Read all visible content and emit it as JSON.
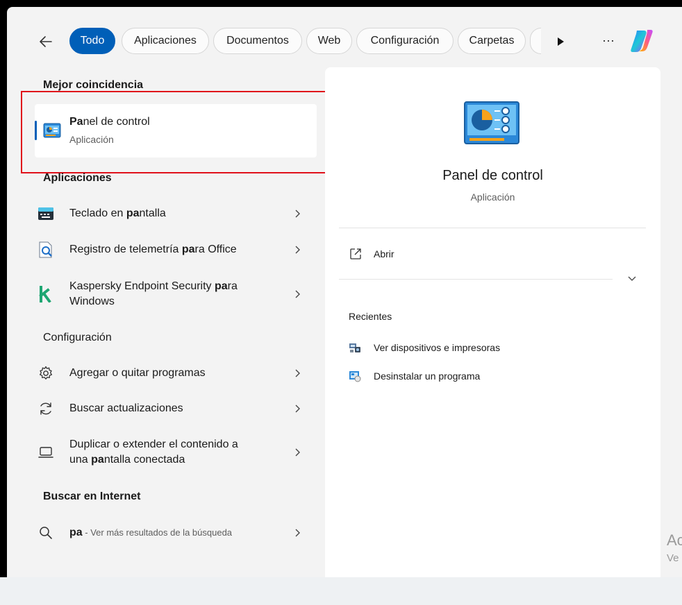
{
  "filters": {
    "tabs": [
      {
        "label": "Todo",
        "active": true
      },
      {
        "label": "Aplicaciones",
        "active": false
      },
      {
        "label": "Documentos",
        "active": false
      },
      {
        "label": "Web",
        "active": false
      },
      {
        "label": "Configuración",
        "active": false
      },
      {
        "label": "Carpetas",
        "active": false
      }
    ],
    "more_label": "···"
  },
  "best_match": {
    "heading": "Mejor coincidencia",
    "title_bold": "Pa",
    "title_rest": "nel de control",
    "subtitle": "Aplicación"
  },
  "apps": {
    "heading": "Aplicaciones",
    "items": [
      {
        "pre": "Teclado en ",
        "bold": "pa",
        "post": "ntalla",
        "icon": "keyboard-icon"
      },
      {
        "pre": "Registro de telemetría ",
        "bold": "pa",
        "post": "ra Office",
        "icon": "telemetry-log-icon"
      },
      {
        "line1_pre": "Kaspersky Endpoint Security ",
        "line1_bold": "pa",
        "line1_post": "ra",
        "line2": "Windows",
        "icon": "kaspersky-icon"
      }
    ]
  },
  "settings": {
    "heading": "Configuración",
    "items": [
      {
        "text": "Agregar o quitar programas",
        "icon": "gear-icon"
      },
      {
        "text": "Buscar actualizaciones",
        "icon": "refresh-icon"
      },
      {
        "line1": "Duplicar o extender el contenido a",
        "line2_pre": "una ",
        "line2_bold": "pa",
        "line2_post": "ntalla conectada",
        "icon": "laptop-icon"
      }
    ]
  },
  "web": {
    "heading": "Buscar en Internet",
    "query": "pa",
    "suffix": " - Ver más resultados de la búsqueda",
    "icon": "search-icon"
  },
  "preview": {
    "title": "Panel de control",
    "subtitle": "Aplicación",
    "open_label": "Abrir",
    "recent_heading": "Recientes",
    "recent": [
      {
        "label": "Ver dispositivos e impresoras",
        "icon": "devices-printers-icon"
      },
      {
        "label": "Desinstalar un programa",
        "icon": "uninstall-program-icon"
      }
    ]
  },
  "watermark": {
    "line1": "Ac",
    "line2": "Ve"
  },
  "colors": {
    "accent": "#005fb8",
    "highlight_box": "#e0101a",
    "panel_bg": "#f3f3f3"
  }
}
